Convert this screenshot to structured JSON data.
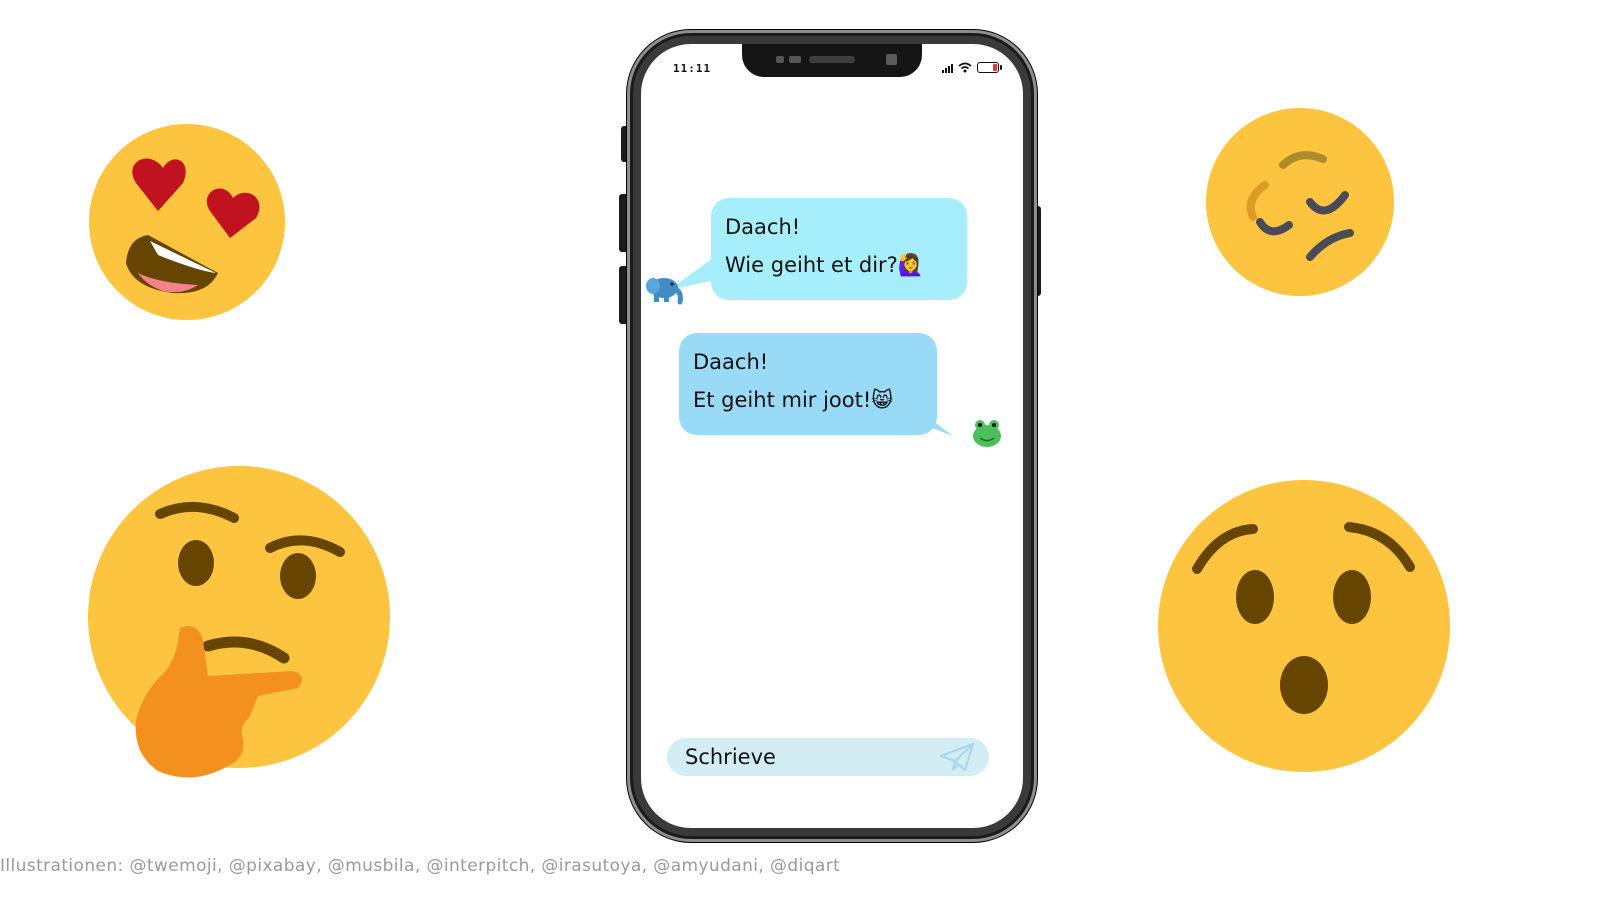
{
  "status_bar": {
    "time": "11:11"
  },
  "chat": {
    "messages": [
      {
        "line1": "Daach!",
        "line2": "Wie geiht et dir?",
        "emoji": "🙋‍♀️",
        "sender_avatar": "elephant-icon"
      },
      {
        "line1": "Daach!",
        "line2": "Et geiht mir joot!",
        "emoji": "😸",
        "sender_avatar": "frog-icon"
      }
    ]
  },
  "input": {
    "placeholder": "Schrieve"
  },
  "decor_emojis": [
    "heart-eyes-emoji",
    "pleading-emoji",
    "thinking-emoji",
    "surprised-emoji"
  ],
  "credits": "Illustrationen: @twemoji, @pixabay, @musbila, @interpitch, @irasutoya, @amyudani, @diqart",
  "colors": {
    "bubble1": "#a6eefc",
    "bubble2": "#99dbf6",
    "input": "#d3edf5",
    "emoji_yellow": "#fcc43f"
  }
}
